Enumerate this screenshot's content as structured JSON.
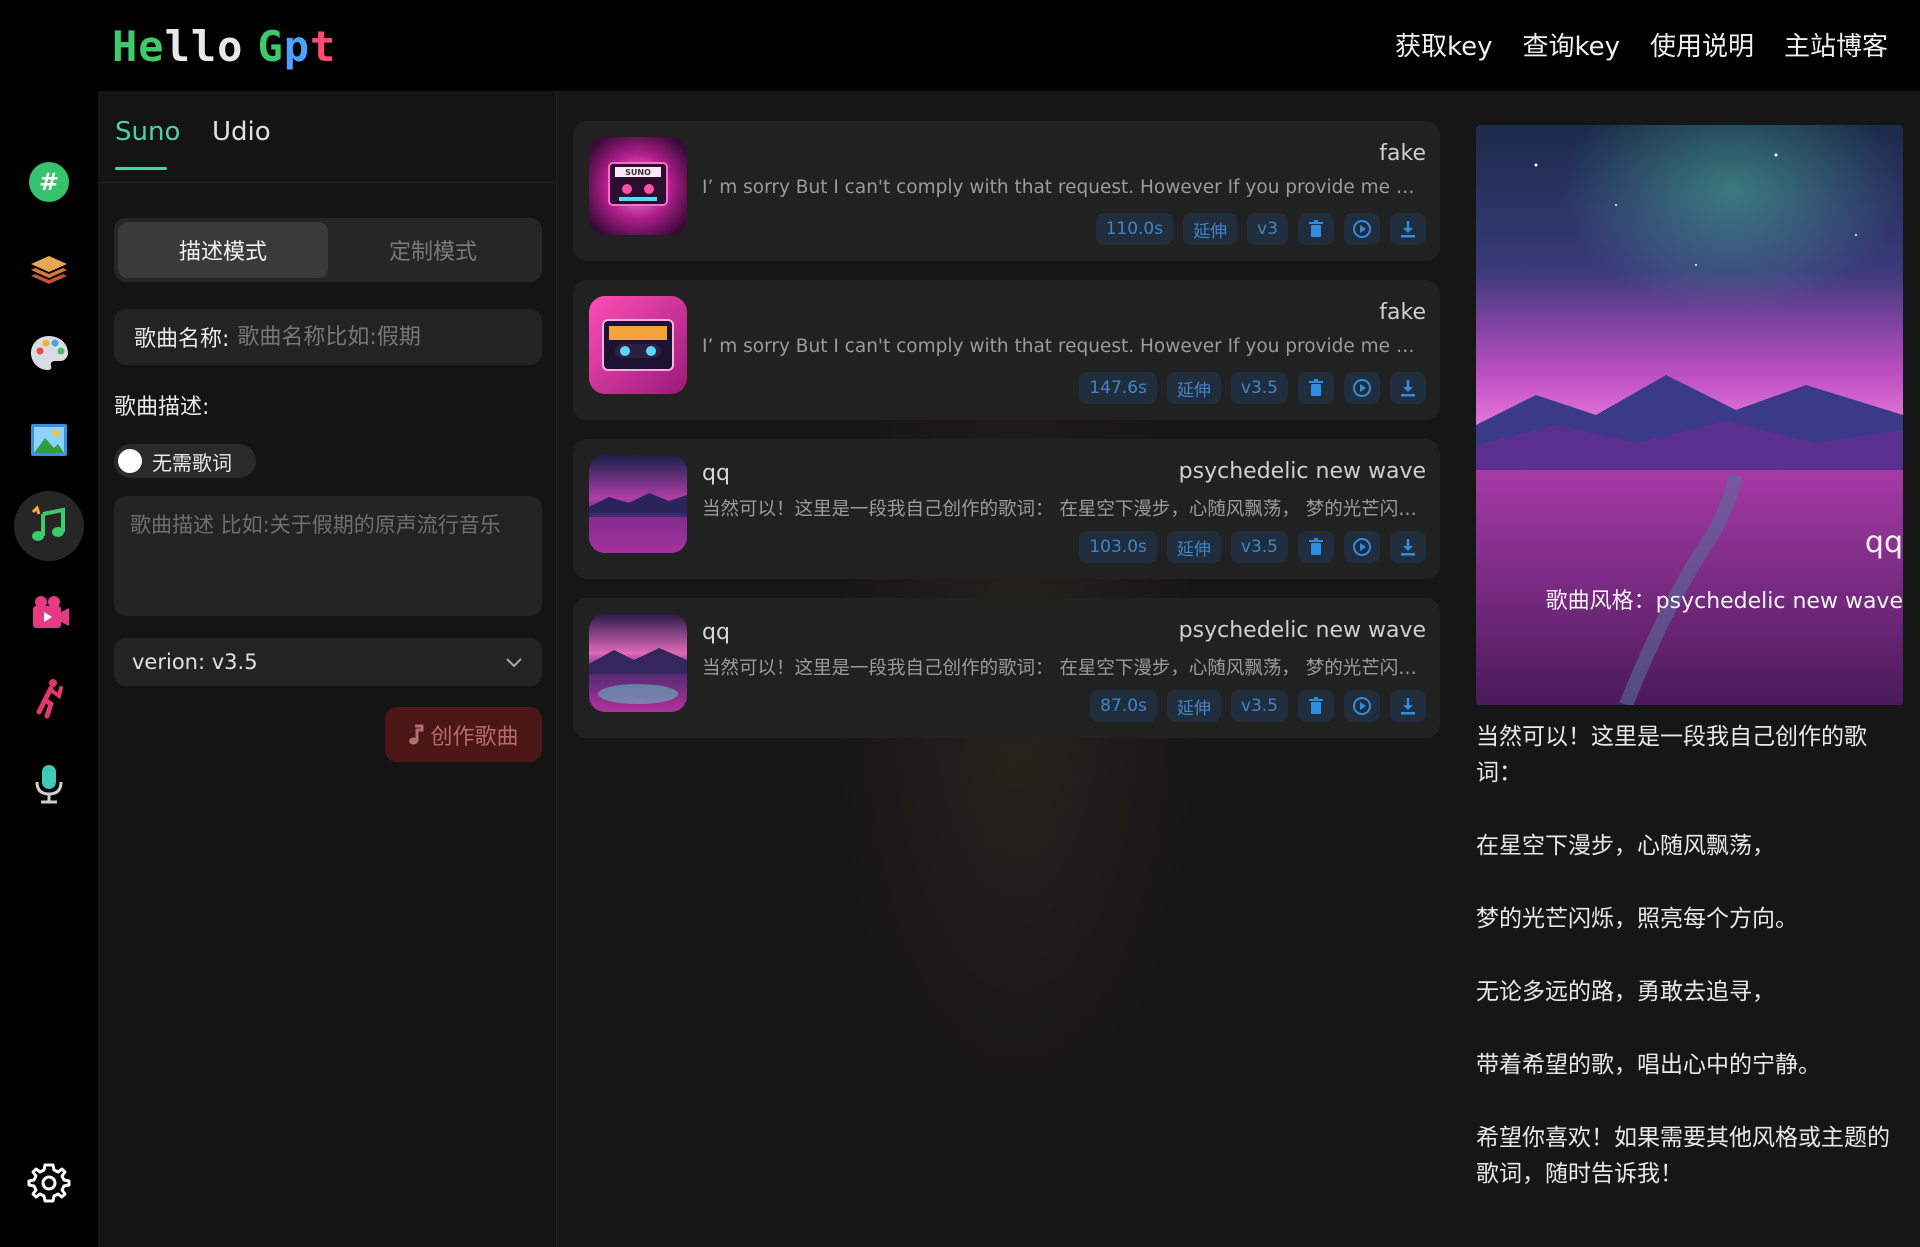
{
  "header": {
    "logo": {
      "part1": "He",
      "part2": "llo",
      "part3": "G",
      "part4": "p",
      "part5": "t"
    },
    "nav": [
      "获取key",
      "查询key",
      "使用说明",
      "主站博客"
    ]
  },
  "rail": {
    "items": [
      {
        "name": "chat-icon",
        "active": false
      },
      {
        "name": "layers-icon",
        "active": false
      },
      {
        "name": "palette-icon",
        "active": false
      },
      {
        "name": "image-icon",
        "active": false
      },
      {
        "name": "music-icon",
        "active": true
      },
      {
        "name": "video-camera-icon",
        "active": false
      },
      {
        "name": "dance-icon",
        "active": false
      },
      {
        "name": "microphone-icon",
        "active": false
      }
    ],
    "settings_icon": "gear-icon"
  },
  "panel": {
    "tabs": [
      "Suno",
      "Udio"
    ],
    "mode": {
      "active": "描述模式",
      "inactive": "定制模式"
    },
    "song_name_label": "歌曲名称:",
    "song_name_placeholder": "歌曲名称比如:假期",
    "desc_label": "歌曲描述:",
    "toggle_label": "无需歌词",
    "desc_placeholder": "歌曲描述 比如:关于假期的原声流行音乐",
    "version": "verion: v3.5",
    "create_label": "创作歌曲"
  },
  "songs": [
    {
      "title": "",
      "style": "fake",
      "text": "I’ m sorry But I can't comply with that request. However If you provide me with another request or topic, I'd be happy to help",
      "duration": "110.0s",
      "extend": "延伸",
      "version": "v3"
    },
    {
      "title": "",
      "style": "fake",
      "text": "I’ m sorry But I can't comply with that request. However If you provide me with another request or topic, I'd be happy to help",
      "duration": "147.6s",
      "extend": "延伸",
      "version": "v3.5"
    },
    {
      "title": "qq",
      "style": "psychedelic new wave",
      "text": "当然可以！这里是一段我自己创作的歌词： 在星空下漫步，心随风飘荡， 梦的光芒闪烁，照亮每个方向。",
      "duration": "103.0s",
      "extend": "延伸",
      "version": "v3.5"
    },
    {
      "title": "qq",
      "style": "psychedelic new wave",
      "text": "当然可以！这里是一段我自己创作的歌词： 在星空下漫步，心随风飘荡， 梦的光芒闪烁，照亮每个方向。",
      "duration": "87.0s",
      "extend": "延伸",
      "version": "v3.5"
    }
  ],
  "detail": {
    "title": "qq",
    "style": "歌曲风格：psychedelic new wave",
    "lyrics": [
      "当然可以！这里是一段我自己创作的歌词：",
      "在星空下漫步，心随风飘荡，",
      "梦的光芒闪烁，照亮每个方向。",
      "无论多远的路，勇敢去追寻，",
      "带着希望的歌，唱出心中的宁静。",
      "希望你喜欢！如果需要其他风格或主题的歌词，随时告诉我！"
    ]
  },
  "colors": {
    "accent": "#4fd1a6",
    "pill_text": "#3f86c9",
    "pill_bg": "#1f2d3c",
    "create_bg": "#4a1616"
  }
}
